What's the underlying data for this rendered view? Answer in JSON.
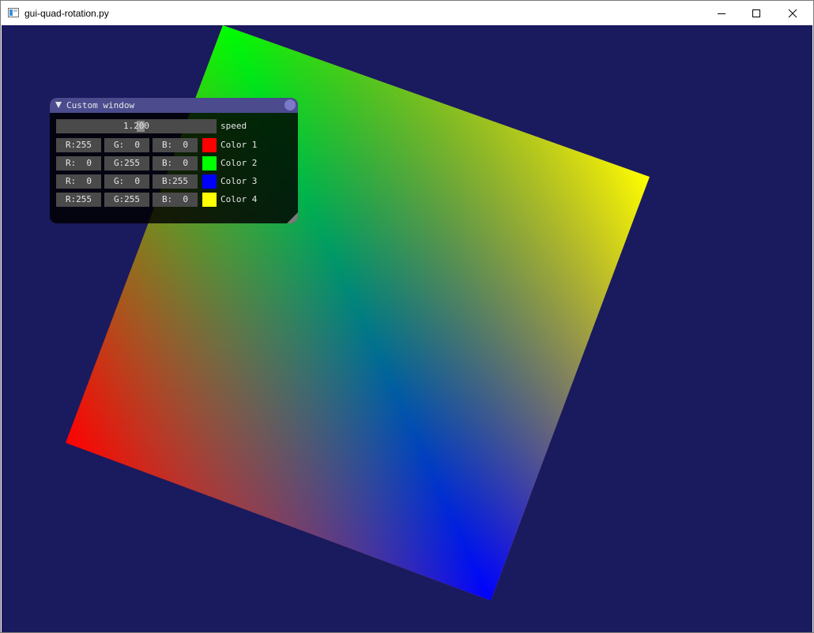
{
  "titlebar": {
    "title": "gui-quad-rotation.py",
    "icon": "app-window-icon",
    "controls": [
      "minimize-icon",
      "maximize-icon",
      "close-icon"
    ]
  },
  "scene": {
    "background_color": "#1a1a5e",
    "quad_corner_colors": [
      "#ff0000",
      "#00ff00",
      "#0000ff",
      "#ffff00"
    ]
  },
  "imgui": {
    "title": "Custom window",
    "speed": {
      "value": "1.200",
      "label": "speed"
    },
    "colors": [
      {
        "r": "R:255",
        "g": "G:  0",
        "b": "B:  0",
        "label": "Color 1",
        "hex": "#ff0000"
      },
      {
        "r": "R:  0",
        "g": "G:255",
        "b": "B:  0",
        "label": "Color 2",
        "hex": "#00ff00"
      },
      {
        "r": "R:  0",
        "g": "G:  0",
        "b": "B:255",
        "label": "Color 3",
        "hex": "#0000ff"
      },
      {
        "r": "R:255",
        "g": "G:255",
        "b": "B:  0",
        "label": "Color 4",
        "hex": "#ffff00"
      }
    ]
  }
}
